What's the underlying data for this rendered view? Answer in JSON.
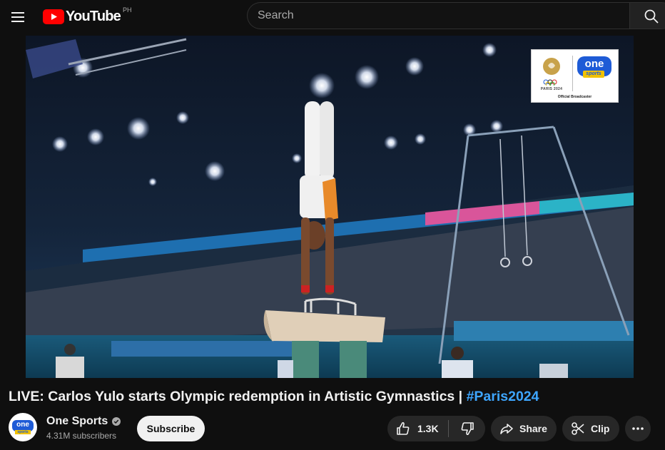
{
  "header": {
    "logo_text": "YouTube",
    "country_code": "PH",
    "search_placeholder": "Search"
  },
  "player": {
    "watermark": {
      "paris_label": "PARIS 2024",
      "brand_top": "one",
      "brand_bottom": "sports",
      "caption": "Official Broadcaster"
    }
  },
  "video": {
    "title": "LIVE: Carlos Yulo starts Olympic redemption in Artistic Gymnastics | ",
    "hashtag": "#Paris2024"
  },
  "channel": {
    "name": "One Sports",
    "subscribers": "4.31M subscribers",
    "avatar_top": "one",
    "avatar_bottom": "sports",
    "subscribe_label": "Subscribe"
  },
  "actions": {
    "like_count": "1.3K",
    "share_label": "Share",
    "clip_label": "Clip"
  },
  "icons": [
    "menu-icon",
    "youtube-logo-icon",
    "search-icon",
    "verified-icon",
    "like-icon",
    "dislike-icon",
    "share-icon",
    "clip-icon",
    "more-icon"
  ],
  "colors": {
    "background": "#0f0f0f",
    "text": "#f1f1f1",
    "secondary_text": "#aaaaaa",
    "hashtag": "#3ea6ff",
    "brand_red": "#ff0000",
    "pill_bg": "#272727"
  }
}
